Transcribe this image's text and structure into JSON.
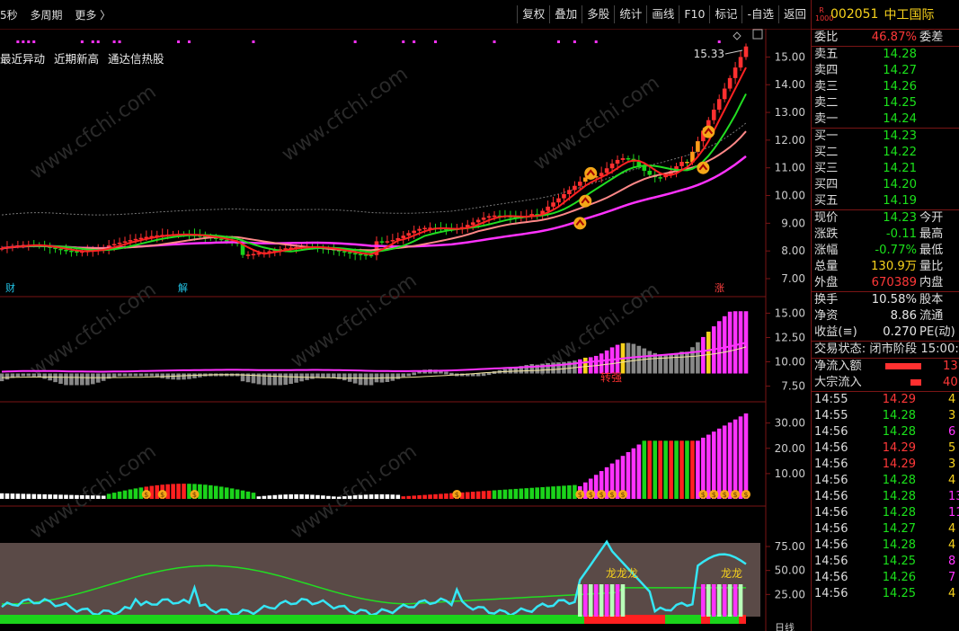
{
  "toolbar": {
    "left_items": [
      "5秒",
      "多周期",
      "更多 〉"
    ],
    "right_buttons": [
      "复权",
      "叠加",
      "多股",
      "统计",
      "画线",
      "F10",
      "标记",
      "-自选",
      "返回"
    ]
  },
  "tags": [
    "最近异动",
    "近期新高",
    "通达信热股"
  ],
  "event_markers": [
    {
      "label": "财",
      "color": "#22c3e6"
    },
    {
      "label": "解",
      "color": "#22c3e6"
    },
    {
      "label": "涨",
      "color": "#ff4040"
    }
  ],
  "price_high_label": "15.33",
  "annotation_text": "转强",
  "dragon_labels": [
    "龙龙龙",
    "龙龙"
  ],
  "bottom_label": "日线",
  "axes": {
    "main": [
      "15.00",
      "14.00",
      "13.00",
      "12.00",
      "11.00",
      "10.00",
      "9.00",
      "8.00",
      "7.00"
    ],
    "ind1": [
      "15.00",
      "12.50",
      "10.00",
      "7.50"
    ],
    "ind2": [
      "30.00",
      "20.00",
      "10.00"
    ],
    "ind3": [
      "75.00",
      "50.00",
      "25.00"
    ]
  },
  "watermark": "www.cfchi.com",
  "colors": {
    "up": "#ff3030",
    "down": "#1bd41b",
    "accent": "#ff32ff",
    "yellow": "#f7d21c",
    "cyan": "#35e6f5"
  },
  "quote": {
    "badge_top": "R",
    "badge_bottom": "1000",
    "code": "002051",
    "name": "中工国际",
    "weibi_label": "委比",
    "weibi_value": "46.87%",
    "weicha_label": "委差",
    "sell": [
      {
        "label": "卖五",
        "price": "14.28"
      },
      {
        "label": "卖四",
        "price": "14.27"
      },
      {
        "label": "卖三",
        "price": "14.26"
      },
      {
        "label": "卖二",
        "price": "14.25"
      },
      {
        "label": "卖一",
        "price": "14.24"
      }
    ],
    "buy": [
      {
        "label": "买一",
        "price": "14.23"
      },
      {
        "label": "买二",
        "price": "14.22"
      },
      {
        "label": "买三",
        "price": "14.21"
      },
      {
        "label": "买四",
        "price": "14.20"
      },
      {
        "label": "买五",
        "price": "14.19"
      }
    ],
    "stats": [
      {
        "l": "现价",
        "v": "14.23",
        "r": "今开",
        "c": "green"
      },
      {
        "l": "涨跌",
        "v": "-0.11",
        "r": "最高",
        "c": "green"
      },
      {
        "l": "涨幅",
        "v": "-0.77%",
        "r": "最低",
        "c": "green"
      },
      {
        "l": "总量",
        "v": "130.9万",
        "r": "量比",
        "c": "yellow"
      },
      {
        "l": "外盘",
        "v": "670389",
        "r": "内盘",
        "c": "red"
      }
    ],
    "stats2": [
      {
        "l": "换手",
        "v": "10.58%",
        "r": "股本"
      },
      {
        "l": "净资",
        "v": "8.86",
        "r": "流通"
      },
      {
        "l": "收益(≡)",
        "v": "0.270",
        "r": "PE(动)"
      }
    ],
    "status_label": "交易状态: 闭市阶段 15:00:0",
    "flows": [
      {
        "label": "净流入额",
        "value": "13",
        "bar": 40
      },
      {
        "label": "大宗流入",
        "value": "40",
        "bar": 12
      }
    ],
    "ticks": [
      {
        "t": "14:55",
        "p": "14.29",
        "v": "4",
        "pc": "red",
        "vc": "yellow"
      },
      {
        "t": "14:55",
        "p": "14.28",
        "v": "3",
        "pc": "green",
        "vc": "yellow"
      },
      {
        "t": "14:56",
        "p": "14.28",
        "v": "6",
        "pc": "green",
        "vc": "magenta"
      },
      {
        "t": "14:56",
        "p": "14.29",
        "v": "5",
        "pc": "red",
        "vc": "yellow"
      },
      {
        "t": "14:56",
        "p": "14.29",
        "v": "3",
        "pc": "red",
        "vc": "yellow"
      },
      {
        "t": "14:56",
        "p": "14.28",
        "v": "4",
        "pc": "green",
        "vc": "yellow"
      },
      {
        "t": "14:56",
        "p": "14.28",
        "v": "13",
        "pc": "green",
        "vc": "magenta"
      },
      {
        "t": "14:56",
        "p": "14.28",
        "v": "11",
        "pc": "green",
        "vc": "magenta"
      },
      {
        "t": "14:56",
        "p": "14.27",
        "v": "4",
        "pc": "green",
        "vc": "yellow"
      },
      {
        "t": "14:56",
        "p": "14.28",
        "v": "4",
        "pc": "green",
        "vc": "yellow"
      },
      {
        "t": "14:56",
        "p": "14.25",
        "v": "8",
        "pc": "green",
        "vc": "magenta"
      },
      {
        "t": "14:56",
        "p": "14.26",
        "v": "7",
        "pc": "green",
        "vc": "magenta"
      },
      {
        "t": "14:56",
        "p": "14.25",
        "v": "4",
        "pc": "green",
        "vc": "yellow"
      }
    ]
  }
}
